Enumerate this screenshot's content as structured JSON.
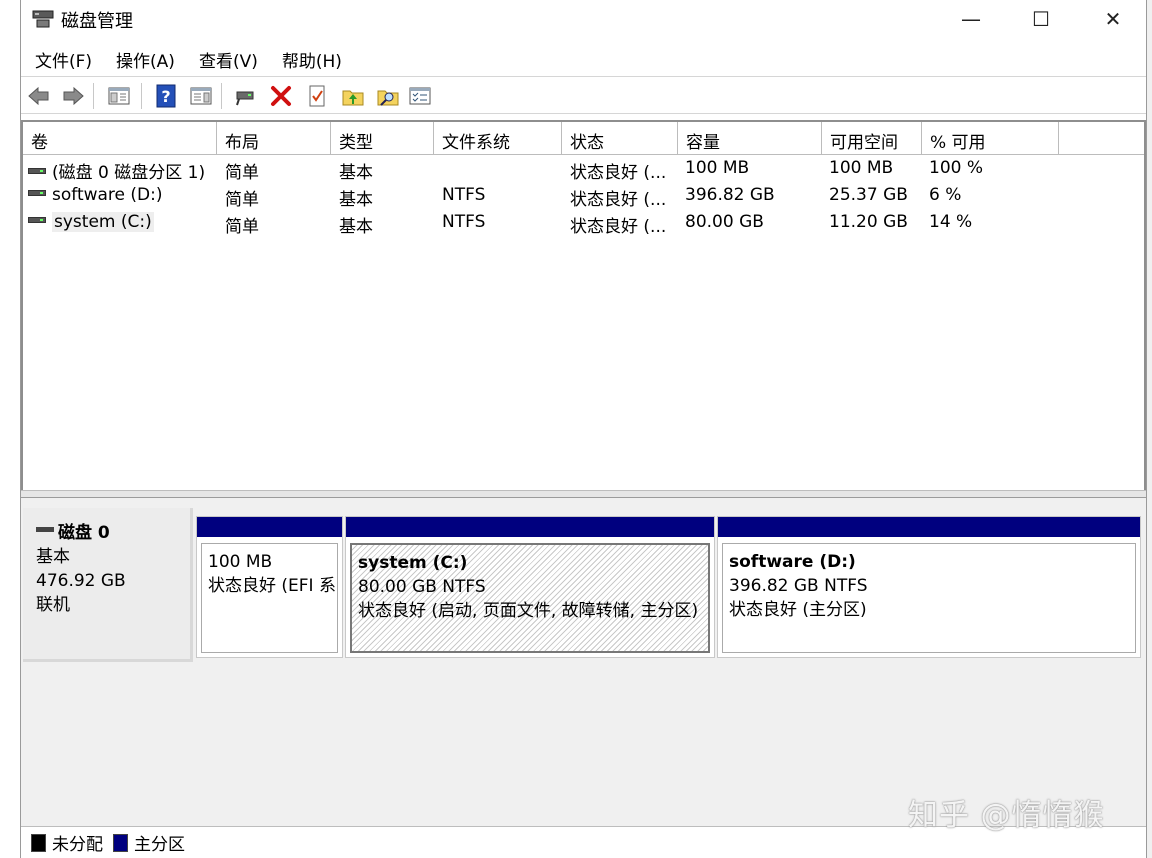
{
  "window": {
    "title": "磁盘管理",
    "controls": {
      "minimize": "—",
      "maximize": "☐",
      "close": "✕"
    }
  },
  "menu": [
    "文件(F)",
    "操作(A)",
    "查看(V)",
    "帮助(H)"
  ],
  "toolbar": {
    "icons": [
      "back-icon",
      "forward-icon",
      "console-tree-icon",
      "help-icon",
      "properties-view-icon",
      "connect-disk-icon",
      "delete-icon",
      "check-icon",
      "folder-up-icon",
      "search-folder-icon",
      "settings-list-icon"
    ]
  },
  "volume_list": {
    "columns": [
      "卷",
      "布局",
      "类型",
      "文件系统",
      "状态",
      "容量",
      "可用空间",
      "% 可用"
    ],
    "rows": [
      {
        "volume": "(磁盘 0 磁盘分区 1)",
        "layout": "简单",
        "type": "基本",
        "fs": "",
        "status": "状态良好 (...",
        "capacity": "100 MB",
        "free": "100 MB",
        "pct": "100 %"
      },
      {
        "volume": "software (D:)",
        "layout": "简单",
        "type": "基本",
        "fs": "NTFS",
        "status": "状态良好 (...",
        "capacity": "396.82 GB",
        "free": "25.37 GB",
        "pct": "6 %"
      },
      {
        "volume": "system (C:)",
        "layout": "简单",
        "type": "基本",
        "fs": "NTFS",
        "status": "状态良好 (...",
        "capacity": "80.00 GB",
        "free": "11.20 GB",
        "pct": "14 %"
      }
    ]
  },
  "disk": {
    "name": "磁盘 0",
    "type": "基本",
    "size": "476.92 GB",
    "state": "联机",
    "partitions": [
      {
        "title": "",
        "size": "100 MB",
        "status": "状态良好 (EFI 系"
      },
      {
        "title": "system  (C:)",
        "size": "80.00 GB NTFS",
        "status": "状态良好 (启动, 页面文件, 故障转储, 主分区)"
      },
      {
        "title": "software  (D:)",
        "size": "396.82 GB NTFS",
        "status": "状态良好 (主分区)"
      }
    ]
  },
  "legend": [
    {
      "label": "未分配",
      "color": "#000000"
    },
    {
      "label": "主分区",
      "color": "#00007f"
    }
  ],
  "watermark": "知乎 @惰惰猴"
}
